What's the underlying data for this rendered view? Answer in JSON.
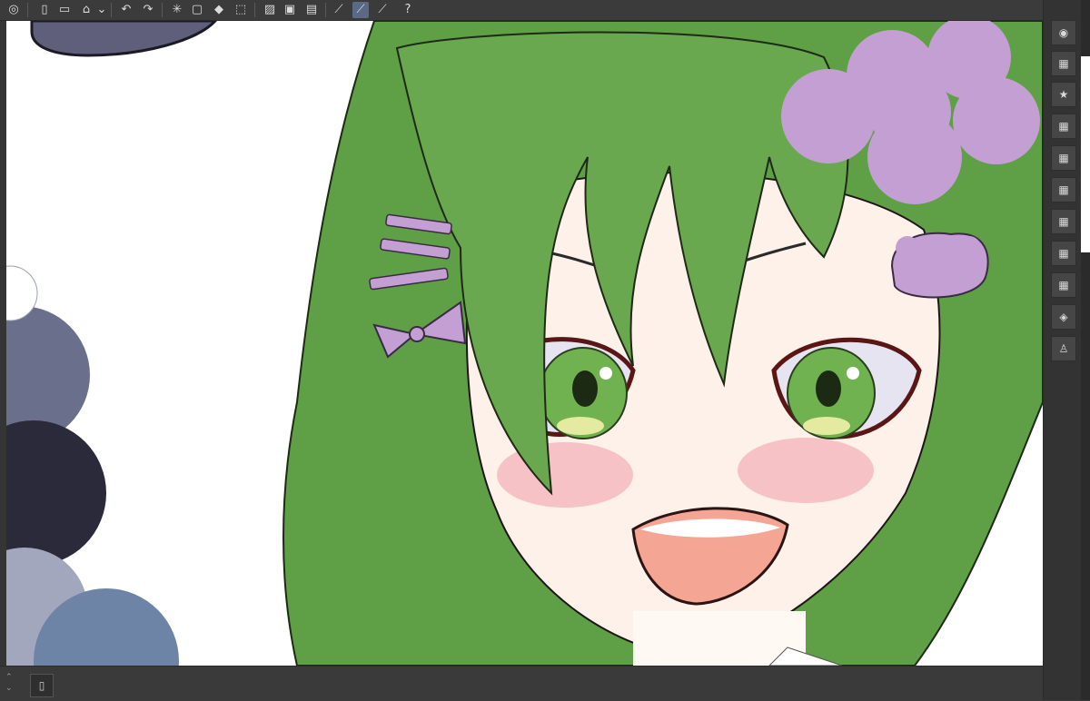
{
  "toolbar": {
    "icons": [
      "app-logo-icon",
      "new-canvas-icon",
      "open-folder-icon",
      "save-icon",
      "dropdown-arrow-icon",
      "undo-icon",
      "redo-icon",
      "loading-icon",
      "deselect-icon",
      "fill-icon",
      "transform-icon",
      "hide-selection-icon",
      "selection-icon",
      "select-all-icon",
      "snap-ruler-icon",
      "snap-special-ruler-icon",
      "snap-grid-icon",
      "help-icon"
    ],
    "glyphs": {
      "app-logo-icon": "◎",
      "new-canvas-icon": "▯",
      "open-folder-icon": "▭",
      "save-icon": "⌂",
      "dropdown-arrow-icon": "⌄",
      "undo-icon": "↶",
      "redo-icon": "↷",
      "loading-icon": "✳",
      "deselect-icon": "▢",
      "fill-icon": "◆",
      "transform-icon": "⬚",
      "hide-selection-icon": "▨",
      "selection-icon": "▣",
      "select-all-icon": "▤",
      "snap-ruler-icon": "⟋",
      "snap-special-ruler-icon": "⟋",
      "snap-grid-icon": "⟋",
      "help-icon": "?"
    }
  },
  "right_panel": {
    "icons": [
      "navigator-icon",
      "sub-tool-icon",
      "material-icon",
      "color-wheel-icon",
      "color-slider-icon",
      "color-set-icon",
      "intermediate-color-icon",
      "approximate-color-icon",
      "color-history-icon",
      "3d-object-icon",
      "pose-icon"
    ],
    "glyphs": {
      "navigator-icon": "◉",
      "sub-tool-icon": "▦",
      "material-icon": "★",
      "color-wheel-icon": "▦",
      "color-slider-icon": "▦",
      "color-set-icon": "▦",
      "intermediate-color-icon": "▦",
      "approximate-color-icon": "▦",
      "color-history-icon": "▦",
      "3d-object-icon": "◈",
      "pose-icon": "♙"
    }
  },
  "bottom_bar": {
    "layer_panel_glyph": "▯",
    "scroll_up_glyph": "⌃",
    "scroll_down_glyph": "⌄"
  },
  "colors": {
    "hair": "#6aa84f",
    "flower": "#c39fd3",
    "skin": "#fdf1ea",
    "blush": "#f6c2c6",
    "circle_dark": "#2b2a3a",
    "circle_slate": "#6a6f8c",
    "circle_blue": "#6e84a6"
  }
}
